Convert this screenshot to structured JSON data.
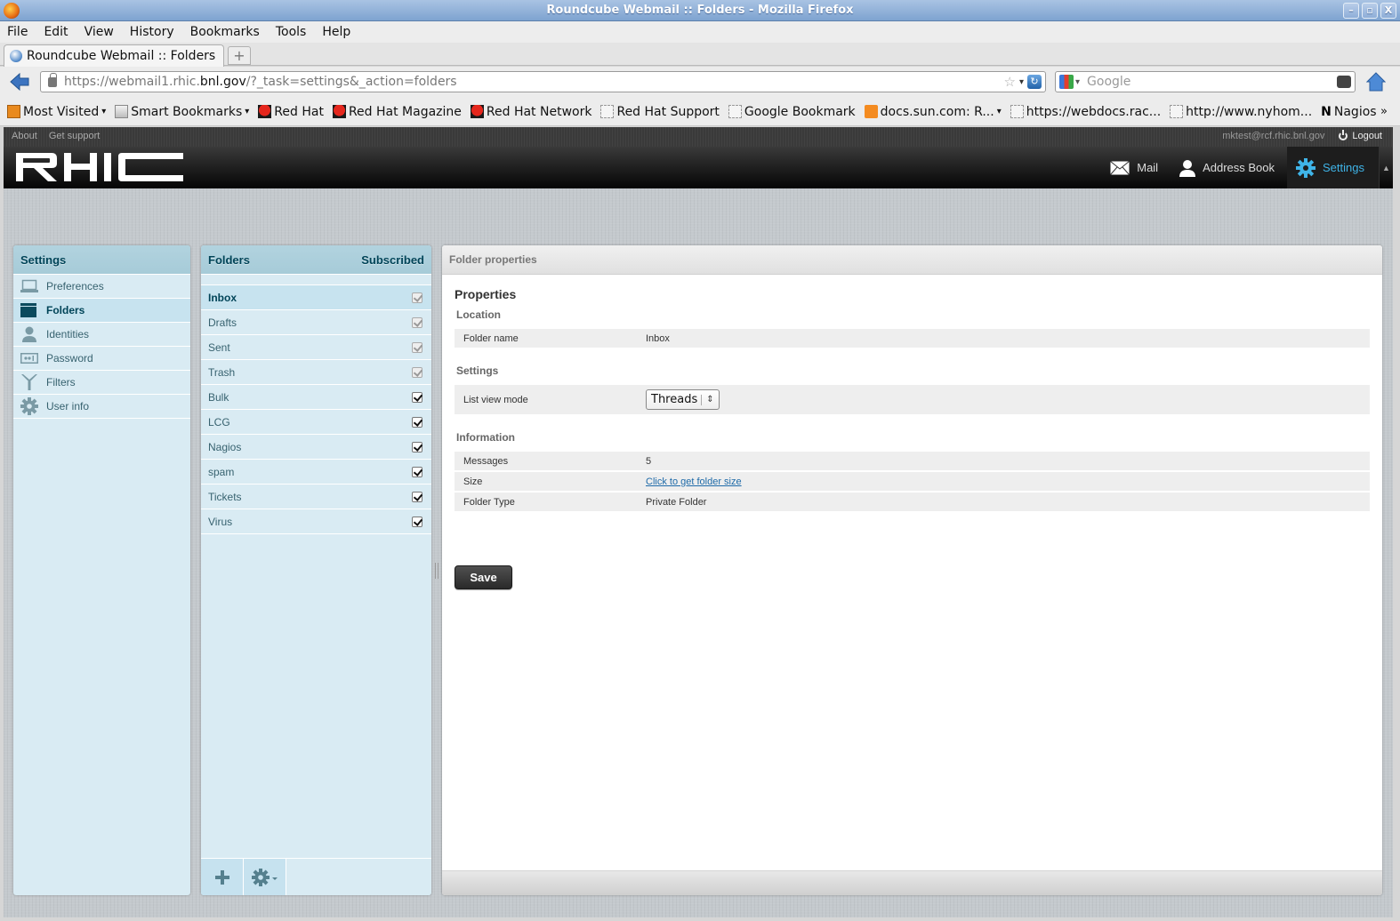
{
  "window": {
    "title": "Roundcube Webmail :: Folders - Mozilla Firefox",
    "buttons": [
      "minimize",
      "maximize",
      "close"
    ]
  },
  "menubar": [
    "File",
    "Edit",
    "View",
    "History",
    "Bookmarks",
    "Tools",
    "Help"
  ],
  "browser_tab": {
    "label": "Roundcube Webmail :: Folders",
    "new_tab": "+"
  },
  "navbar": {
    "url_prefix": "https://webmail1.rhic.",
    "url_host": "bnl.gov",
    "url_suffix": "/?_task=settings&_action=folders",
    "search_placeholder": "Google"
  },
  "bookmarks": [
    {
      "label": "Most Visited",
      "icon": "most-visited-icon",
      "dropdown": true
    },
    {
      "label": "Smart Bookmarks",
      "icon": "folder-icon",
      "dropdown": true
    },
    {
      "label": "Red Hat",
      "icon": "redhat-icon"
    },
    {
      "label": "Red Hat Magazine",
      "icon": "redhat-icon"
    },
    {
      "label": "Red Hat Network",
      "icon": "redhat-icon"
    },
    {
      "label": "Red Hat Support",
      "icon": "page-icon"
    },
    {
      "label": "Google Bookmark",
      "icon": "page-icon"
    },
    {
      "label": "docs.sun.com: R...",
      "icon": "rss-icon",
      "dropdown": true
    },
    {
      "label": "https://webdocs.rac...",
      "icon": "page-icon"
    },
    {
      "label": "http://www.nyhom...",
      "icon": "page-icon"
    },
    {
      "label": "Nagios",
      "icon": "nagios-icon"
    }
  ],
  "bookmarks_overflow": "»",
  "app": {
    "topline": {
      "about": "About",
      "support": "Get support",
      "user": "mktest@rcf.rhic.bnl.gov",
      "logout": "Logout"
    },
    "logo": "RHIC",
    "tasks": [
      {
        "label": "Mail",
        "icon": "mail-icon",
        "active": false
      },
      {
        "label": "Address Book",
        "icon": "address-book-icon",
        "active": false
      },
      {
        "label": "Settings",
        "icon": "settings-gear-icon",
        "active": true
      }
    ],
    "accent_color": "#3fb4e8",
    "settings_nav": {
      "title": "Settings",
      "items": [
        {
          "label": "Preferences",
          "icon": "laptop-icon",
          "selected": false
        },
        {
          "label": "Folders",
          "icon": "folder-icon",
          "selected": true
        },
        {
          "label": "Identities",
          "icon": "person-icon",
          "selected": false
        },
        {
          "label": "Password",
          "icon": "password-icon",
          "selected": false
        },
        {
          "label": "Filters",
          "icon": "filter-icon",
          "selected": false
        },
        {
          "label": "User info",
          "icon": "gear-icon",
          "selected": false
        }
      ]
    },
    "folders": {
      "title": "Folders",
      "subscribed_header": "Subscribed",
      "rows": [
        {
          "name": "Inbox",
          "subscribed": true,
          "disabled": true,
          "selected": true
        },
        {
          "name": "Drafts",
          "subscribed": true,
          "disabled": true,
          "selected": false
        },
        {
          "name": "Sent",
          "subscribed": true,
          "disabled": true,
          "selected": false
        },
        {
          "name": "Trash",
          "subscribed": true,
          "disabled": true,
          "selected": false
        },
        {
          "name": "Bulk",
          "subscribed": true,
          "disabled": false,
          "selected": false
        },
        {
          "name": "LCG",
          "subscribed": true,
          "disabled": false,
          "selected": false
        },
        {
          "name": "Nagios",
          "subscribed": true,
          "disabled": false,
          "selected": false
        },
        {
          "name": "spam",
          "subscribed": true,
          "disabled": false,
          "selected": false
        },
        {
          "name": "Tickets",
          "subscribed": true,
          "disabled": false,
          "selected": false
        },
        {
          "name": "Virus",
          "subscribed": true,
          "disabled": false,
          "selected": false
        }
      ],
      "footer": {
        "add_icon": "plus-icon",
        "actions_icon": "gear-menu-icon"
      }
    },
    "properties": {
      "header": "Folder properties",
      "title": "Properties",
      "location": {
        "label": "Location",
        "folder_name_label": "Folder name",
        "folder_name_value": "Inbox"
      },
      "settings": {
        "label": "Settings",
        "list_view_mode_label": "List view mode",
        "list_view_mode_value": "Threads"
      },
      "information": {
        "label": "Information",
        "messages_label": "Messages",
        "messages_value": "5",
        "size_label": "Size",
        "size_link": "Click to get folder size",
        "type_label": "Folder Type",
        "type_value": "Private Folder"
      },
      "save_label": "Save"
    }
  }
}
